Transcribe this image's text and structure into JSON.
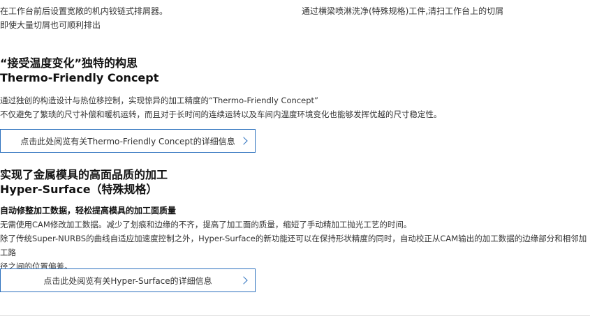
{
  "top": {
    "left_line1": "在工作台前后设置宽敞的机内铰链式排屑器。",
    "left_line2": "即使大量切屑也可顺利排出",
    "right_line1": "通过横梁喷淋洗净(特殊规格)工件,清扫工作台上的切屑"
  },
  "thermo": {
    "heading_cn": "“接受温度变化”独特的构思",
    "heading_en": "Thermo-Friendly Concept",
    "text1": "通过独创的构造设计与热位移控制，实现惊异的加工精度的“Thermo-Friendly Concept”",
    "text2": "不仅避免了繁琐的尺寸补偿和暖机运转，而且对于长时间的连续运转以及车间内温度环境变化也能够发挥优越的尺寸稳定性。",
    "link_label": "点击此处阅览有关Thermo-Friendly Concept的详细信息",
    "link_icon": "chevron-right-icon"
  },
  "hyper": {
    "heading_cn": "实现了金属模具的高面品质的加工",
    "heading_en": "Hyper-Surface（特殊规格）",
    "subheading": "自动修整加工数据，轻松提高模具的加工面质量",
    "text1": "无需使用CAM修改加工数据。减少了划痕和边缘的不齐，提高了加工面的质量，缩短了手动精加工抛光工艺的时间。",
    "text2a": "除了传统Super-NURBS的曲线自适应加速度控制之外，Hyper-Surface的新功能还可以在保持形状精度的同时，自动校正从CAM输出的加工数据的边缘部分和相邻加工路",
    "text2b": "径之间的位置偏差。",
    "link_label": "点击此处阅览有关Hyper-Surface的详细信息",
    "link_icon": "chevron-right-icon"
  },
  "colors": {
    "accent": "#2a6fbd",
    "text": "#333333",
    "heading": "#111111"
  }
}
